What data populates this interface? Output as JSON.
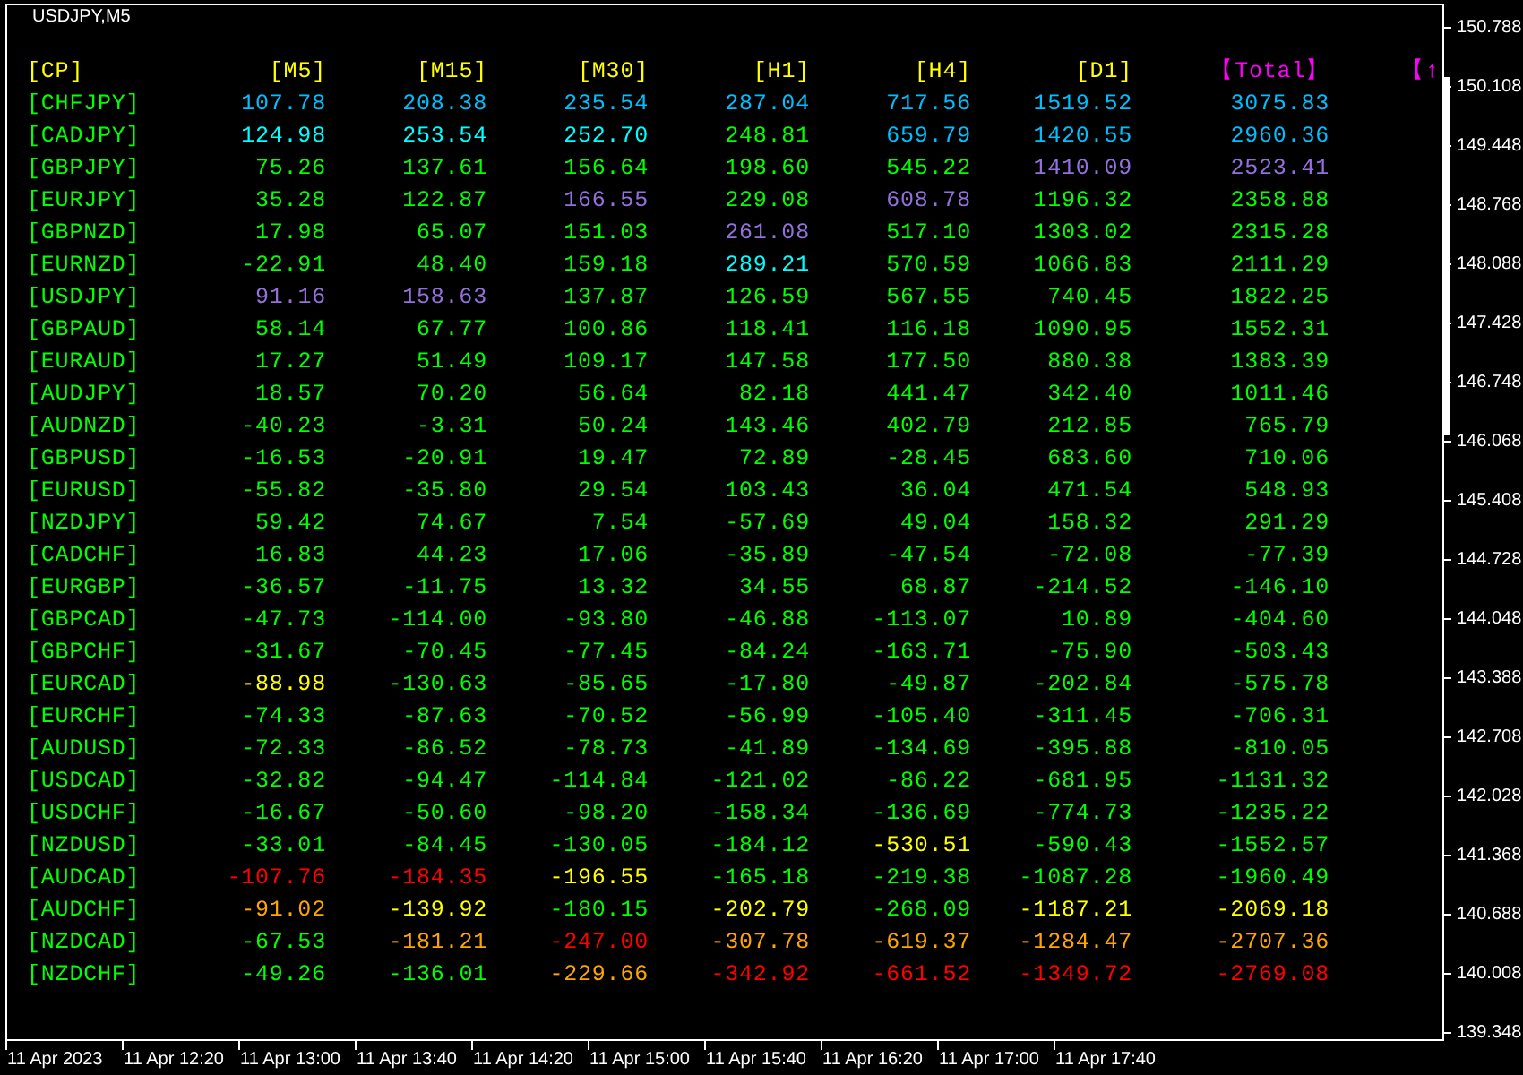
{
  "chart": {
    "title": "USDJPY,M5"
  },
  "table": {
    "columns": [
      {
        "label": "[CP]",
        "color": "#ffff00"
      },
      {
        "label": "[M5]",
        "color": "#ffff00"
      },
      {
        "label": "[M15]",
        "color": "#ffff00"
      },
      {
        "label": "[M30]",
        "color": "#ffff00"
      },
      {
        "label": "[H1]",
        "color": "#ffff00"
      },
      {
        "label": "[H4]",
        "color": "#ffff00"
      },
      {
        "label": "[D1]",
        "color": "#ffff00"
      },
      {
        "label": "【Total】",
        "color": "#ff00ff"
      },
      {
        "label": "【↑",
        "color": "#ff00ff"
      }
    ],
    "rows": [
      {
        "cells": [
          {
            "text": "[CHFJPY]",
            "color": "#00ff00"
          },
          {
            "text": "107.78",
            "color": "#00bfff"
          },
          {
            "text": "208.38",
            "color": "#00bfff"
          },
          {
            "text": "235.54",
            "color": "#00bfff"
          },
          {
            "text": "287.04",
            "color": "#00bfff"
          },
          {
            "text": "717.56",
            "color": "#00bfff"
          },
          {
            "text": "1519.52",
            "color": "#00bfff"
          },
          {
            "text": "3075.83",
            "color": "#00bfff"
          }
        ]
      },
      {
        "cells": [
          {
            "text": "[CADJPY]",
            "color": "#00ff00"
          },
          {
            "text": "124.98",
            "color": "#00ffff"
          },
          {
            "text": "253.54",
            "color": "#00ffff"
          },
          {
            "text": "252.70",
            "color": "#00ffff"
          },
          {
            "text": "248.81",
            "color": "#00ff00"
          },
          {
            "text": "659.79",
            "color": "#00bfff"
          },
          {
            "text": "1420.55",
            "color": "#00bfff"
          },
          {
            "text": "2960.36",
            "color": "#00bfff"
          }
        ]
      },
      {
        "cells": [
          {
            "text": "[GBPJPY]",
            "color": "#00ff00"
          },
          {
            "text": "75.26",
            "color": "#00ff00"
          },
          {
            "text": "137.61",
            "color": "#00ff00"
          },
          {
            "text": "156.64",
            "color": "#00ff00"
          },
          {
            "text": "198.60",
            "color": "#00ff00"
          },
          {
            "text": "545.22",
            "color": "#00ff00"
          },
          {
            "text": "1410.09",
            "color": "#9370db"
          },
          {
            "text": "2523.41",
            "color": "#9370db"
          }
        ]
      },
      {
        "cells": [
          {
            "text": "[EURJPY]",
            "color": "#00ff00"
          },
          {
            "text": "35.28",
            "color": "#00ff00"
          },
          {
            "text": "122.87",
            "color": "#00ff00"
          },
          {
            "text": "166.55",
            "color": "#9370db"
          },
          {
            "text": "229.08",
            "color": "#00ff00"
          },
          {
            "text": "608.78",
            "color": "#9370db"
          },
          {
            "text": "1196.32",
            "color": "#00ff00"
          },
          {
            "text": "2358.88",
            "color": "#00ff00"
          }
        ]
      },
      {
        "cells": [
          {
            "text": "[GBPNZD]",
            "color": "#00ff00"
          },
          {
            "text": "17.98",
            "color": "#00ff00"
          },
          {
            "text": "65.07",
            "color": "#00ff00"
          },
          {
            "text": "151.03",
            "color": "#00ff00"
          },
          {
            "text": "261.08",
            "color": "#9370db"
          },
          {
            "text": "517.10",
            "color": "#00ff00"
          },
          {
            "text": "1303.02",
            "color": "#00ff00"
          },
          {
            "text": "2315.28",
            "color": "#00ff00"
          }
        ]
      },
      {
        "cells": [
          {
            "text": "[EURNZD]",
            "color": "#00ff00"
          },
          {
            "text": "-22.91",
            "color": "#00ff00"
          },
          {
            "text": "48.40",
            "color": "#00ff00"
          },
          {
            "text": "159.18",
            "color": "#00ff00"
          },
          {
            "text": "289.21",
            "color": "#00ffff"
          },
          {
            "text": "570.59",
            "color": "#00ff00"
          },
          {
            "text": "1066.83",
            "color": "#00ff00"
          },
          {
            "text": "2111.29",
            "color": "#00ff00"
          }
        ]
      },
      {
        "cells": [
          {
            "text": "[USDJPY]",
            "color": "#00ff00"
          },
          {
            "text": "91.16",
            "color": "#9370db"
          },
          {
            "text": "158.63",
            "color": "#9370db"
          },
          {
            "text": "137.87",
            "color": "#00ff00"
          },
          {
            "text": "126.59",
            "color": "#00ff00"
          },
          {
            "text": "567.55",
            "color": "#00ff00"
          },
          {
            "text": "740.45",
            "color": "#00ff00"
          },
          {
            "text": "1822.25",
            "color": "#00ff00"
          }
        ]
      },
      {
        "cells": [
          {
            "text": "[GBPAUD]",
            "color": "#00ff00"
          },
          {
            "text": "58.14",
            "color": "#00ff00"
          },
          {
            "text": "67.77",
            "color": "#00ff00"
          },
          {
            "text": "100.86",
            "color": "#00ff00"
          },
          {
            "text": "118.41",
            "color": "#00ff00"
          },
          {
            "text": "116.18",
            "color": "#00ff00"
          },
          {
            "text": "1090.95",
            "color": "#00ff00"
          },
          {
            "text": "1552.31",
            "color": "#00ff00"
          }
        ]
      },
      {
        "cells": [
          {
            "text": "[EURAUD]",
            "color": "#00ff00"
          },
          {
            "text": "17.27",
            "color": "#00ff00"
          },
          {
            "text": "51.49",
            "color": "#00ff00"
          },
          {
            "text": "109.17",
            "color": "#00ff00"
          },
          {
            "text": "147.58",
            "color": "#00ff00"
          },
          {
            "text": "177.50",
            "color": "#00ff00"
          },
          {
            "text": "880.38",
            "color": "#00ff00"
          },
          {
            "text": "1383.39",
            "color": "#00ff00"
          }
        ]
      },
      {
        "cells": [
          {
            "text": "[AUDJPY]",
            "color": "#00ff00"
          },
          {
            "text": "18.57",
            "color": "#00ff00"
          },
          {
            "text": "70.20",
            "color": "#00ff00"
          },
          {
            "text": "56.64",
            "color": "#00ff00"
          },
          {
            "text": "82.18",
            "color": "#00ff00"
          },
          {
            "text": "441.47",
            "color": "#00ff00"
          },
          {
            "text": "342.40",
            "color": "#00ff00"
          },
          {
            "text": "1011.46",
            "color": "#00ff00"
          }
        ]
      },
      {
        "cells": [
          {
            "text": "[AUDNZD]",
            "color": "#00ff00"
          },
          {
            "text": "-40.23",
            "color": "#00ff00"
          },
          {
            "text": "-3.31",
            "color": "#00ff00"
          },
          {
            "text": "50.24",
            "color": "#00ff00"
          },
          {
            "text": "143.46",
            "color": "#00ff00"
          },
          {
            "text": "402.79",
            "color": "#00ff00"
          },
          {
            "text": "212.85",
            "color": "#00ff00"
          },
          {
            "text": "765.79",
            "color": "#00ff00"
          }
        ]
      },
      {
        "cells": [
          {
            "text": "[GBPUSD]",
            "color": "#00ff00"
          },
          {
            "text": "-16.53",
            "color": "#00ff00"
          },
          {
            "text": "-20.91",
            "color": "#00ff00"
          },
          {
            "text": "19.47",
            "color": "#00ff00"
          },
          {
            "text": "72.89",
            "color": "#00ff00"
          },
          {
            "text": "-28.45",
            "color": "#00ff00"
          },
          {
            "text": "683.60",
            "color": "#00ff00"
          },
          {
            "text": "710.06",
            "color": "#00ff00"
          }
        ]
      },
      {
        "cells": [
          {
            "text": "[EURUSD]",
            "color": "#00ff00"
          },
          {
            "text": "-55.82",
            "color": "#00ff00"
          },
          {
            "text": "-35.80",
            "color": "#00ff00"
          },
          {
            "text": "29.54",
            "color": "#00ff00"
          },
          {
            "text": "103.43",
            "color": "#00ff00"
          },
          {
            "text": "36.04",
            "color": "#00ff00"
          },
          {
            "text": "471.54",
            "color": "#00ff00"
          },
          {
            "text": "548.93",
            "color": "#00ff00"
          }
        ]
      },
      {
        "cells": [
          {
            "text": "[NZDJPY]",
            "color": "#00ff00"
          },
          {
            "text": "59.42",
            "color": "#00ff00"
          },
          {
            "text": "74.67",
            "color": "#00ff00"
          },
          {
            "text": "7.54",
            "color": "#00ff00"
          },
          {
            "text": "-57.69",
            "color": "#00ff00"
          },
          {
            "text": "49.04",
            "color": "#00ff00"
          },
          {
            "text": "158.32",
            "color": "#00ff00"
          },
          {
            "text": "291.29",
            "color": "#00ff00"
          }
        ]
      },
      {
        "cells": [
          {
            "text": "[CADCHF]",
            "color": "#00ff00"
          },
          {
            "text": "16.83",
            "color": "#00ff00"
          },
          {
            "text": "44.23",
            "color": "#00ff00"
          },
          {
            "text": "17.06",
            "color": "#00ff00"
          },
          {
            "text": "-35.89",
            "color": "#00ff00"
          },
          {
            "text": "-47.54",
            "color": "#00ff00"
          },
          {
            "text": "-72.08",
            "color": "#00ff00"
          },
          {
            "text": "-77.39",
            "color": "#00ff00"
          }
        ]
      },
      {
        "cells": [
          {
            "text": "[EURGBP]",
            "color": "#00ff00"
          },
          {
            "text": "-36.57",
            "color": "#00ff00"
          },
          {
            "text": "-11.75",
            "color": "#00ff00"
          },
          {
            "text": "13.32",
            "color": "#00ff00"
          },
          {
            "text": "34.55",
            "color": "#00ff00"
          },
          {
            "text": "68.87",
            "color": "#00ff00"
          },
          {
            "text": "-214.52",
            "color": "#00ff00"
          },
          {
            "text": "-146.10",
            "color": "#00ff00"
          }
        ]
      },
      {
        "cells": [
          {
            "text": "[GBPCAD]",
            "color": "#00ff00"
          },
          {
            "text": "-47.73",
            "color": "#00ff00"
          },
          {
            "text": "-114.00",
            "color": "#00ff00"
          },
          {
            "text": "-93.80",
            "color": "#00ff00"
          },
          {
            "text": "-46.88",
            "color": "#00ff00"
          },
          {
            "text": "-113.07",
            "color": "#00ff00"
          },
          {
            "text": "10.89",
            "color": "#00ff00"
          },
          {
            "text": "-404.60",
            "color": "#00ff00"
          }
        ]
      },
      {
        "cells": [
          {
            "text": "[GBPCHF]",
            "color": "#00ff00"
          },
          {
            "text": "-31.67",
            "color": "#00ff00"
          },
          {
            "text": "-70.45",
            "color": "#00ff00"
          },
          {
            "text": "-77.45",
            "color": "#00ff00"
          },
          {
            "text": "-84.24",
            "color": "#00ff00"
          },
          {
            "text": "-163.71",
            "color": "#00ff00"
          },
          {
            "text": "-75.90",
            "color": "#00ff00"
          },
          {
            "text": "-503.43",
            "color": "#00ff00"
          }
        ]
      },
      {
        "cells": [
          {
            "text": "[EURCAD]",
            "color": "#00ff00"
          },
          {
            "text": "-88.98",
            "color": "#ffff00"
          },
          {
            "text": "-130.63",
            "color": "#00ff00"
          },
          {
            "text": "-85.65",
            "color": "#00ff00"
          },
          {
            "text": "-17.80",
            "color": "#00ff00"
          },
          {
            "text": "-49.87",
            "color": "#00ff00"
          },
          {
            "text": "-202.84",
            "color": "#00ff00"
          },
          {
            "text": "-575.78",
            "color": "#00ff00"
          }
        ]
      },
      {
        "cells": [
          {
            "text": "[EURCHF]",
            "color": "#00ff00"
          },
          {
            "text": "-74.33",
            "color": "#00ff00"
          },
          {
            "text": "-87.63",
            "color": "#00ff00"
          },
          {
            "text": "-70.52",
            "color": "#00ff00"
          },
          {
            "text": "-56.99",
            "color": "#00ff00"
          },
          {
            "text": "-105.40",
            "color": "#00ff00"
          },
          {
            "text": "-311.45",
            "color": "#00ff00"
          },
          {
            "text": "-706.31",
            "color": "#00ff00"
          }
        ]
      },
      {
        "cells": [
          {
            "text": "[AUDUSD]",
            "color": "#00ff00"
          },
          {
            "text": "-72.33",
            "color": "#00ff00"
          },
          {
            "text": "-86.52",
            "color": "#00ff00"
          },
          {
            "text": "-78.73",
            "color": "#00ff00"
          },
          {
            "text": "-41.89",
            "color": "#00ff00"
          },
          {
            "text": "-134.69",
            "color": "#00ff00"
          },
          {
            "text": "-395.88",
            "color": "#00ff00"
          },
          {
            "text": "-810.05",
            "color": "#00ff00"
          }
        ]
      },
      {
        "cells": [
          {
            "text": "[USDCAD]",
            "color": "#00ff00"
          },
          {
            "text": "-32.82",
            "color": "#00ff00"
          },
          {
            "text": "-94.47",
            "color": "#00ff00"
          },
          {
            "text": "-114.84",
            "color": "#00ff00"
          },
          {
            "text": "-121.02",
            "color": "#00ff00"
          },
          {
            "text": "-86.22",
            "color": "#00ff00"
          },
          {
            "text": "-681.95",
            "color": "#00ff00"
          },
          {
            "text": "-1131.32",
            "color": "#00ff00"
          }
        ]
      },
      {
        "cells": [
          {
            "text": "[USDCHF]",
            "color": "#00ff00"
          },
          {
            "text": "-16.67",
            "color": "#00ff00"
          },
          {
            "text": "-50.60",
            "color": "#00ff00"
          },
          {
            "text": "-98.20",
            "color": "#00ff00"
          },
          {
            "text": "-158.34",
            "color": "#00ff00"
          },
          {
            "text": "-136.69",
            "color": "#00ff00"
          },
          {
            "text": "-774.73",
            "color": "#00ff00"
          },
          {
            "text": "-1235.22",
            "color": "#00ff00"
          }
        ]
      },
      {
        "cells": [
          {
            "text": "[NZDUSD]",
            "color": "#00ff00"
          },
          {
            "text": "-33.01",
            "color": "#00ff00"
          },
          {
            "text": "-84.45",
            "color": "#00ff00"
          },
          {
            "text": "-130.05",
            "color": "#00ff00"
          },
          {
            "text": "-184.12",
            "color": "#00ff00"
          },
          {
            "text": "-530.51",
            "color": "#ffff00"
          },
          {
            "text": "-590.43",
            "color": "#00ff00"
          },
          {
            "text": "-1552.57",
            "color": "#00ff00"
          }
        ]
      },
      {
        "cells": [
          {
            "text": "[AUDCAD]",
            "color": "#00ff00"
          },
          {
            "text": "-107.76",
            "color": "#ff0000"
          },
          {
            "text": "-184.35",
            "color": "#ff0000"
          },
          {
            "text": "-196.55",
            "color": "#ffff00"
          },
          {
            "text": "-165.18",
            "color": "#00ff00"
          },
          {
            "text": "-219.38",
            "color": "#00ff00"
          },
          {
            "text": "-1087.28",
            "color": "#00ff00"
          },
          {
            "text": "-1960.49",
            "color": "#00ff00"
          }
        ]
      },
      {
        "cells": [
          {
            "text": "[AUDCHF]",
            "color": "#00ff00"
          },
          {
            "text": "-91.02",
            "color": "#ffa500"
          },
          {
            "text": "-139.92",
            "color": "#ffff00"
          },
          {
            "text": "-180.15",
            "color": "#00ff00"
          },
          {
            "text": "-202.79",
            "color": "#ffff00"
          },
          {
            "text": "-268.09",
            "color": "#00ff00"
          },
          {
            "text": "-1187.21",
            "color": "#ffff00"
          },
          {
            "text": "-2069.18",
            "color": "#ffff00"
          }
        ]
      },
      {
        "cells": [
          {
            "text": "[NZDCAD]",
            "color": "#00ff00"
          },
          {
            "text": "-67.53",
            "color": "#00ff00"
          },
          {
            "text": "-181.21",
            "color": "#ffa500"
          },
          {
            "text": "-247.00",
            "color": "#ff0000"
          },
          {
            "text": "-307.78",
            "color": "#ffa500"
          },
          {
            "text": "-619.37",
            "color": "#ffa500"
          },
          {
            "text": "-1284.47",
            "color": "#ffa500"
          },
          {
            "text": "-2707.36",
            "color": "#ffa500"
          }
        ]
      },
      {
        "cells": [
          {
            "text": "[NZDCHF]",
            "color": "#00ff00"
          },
          {
            "text": "-49.26",
            "color": "#00ff00"
          },
          {
            "text": "-136.01",
            "color": "#00ff00"
          },
          {
            "text": "-229.66",
            "color": "#ffa500"
          },
          {
            "text": "-342.92",
            "color": "#ff0000"
          },
          {
            "text": "-661.52",
            "color": "#ff0000"
          },
          {
            "text": "-1349.72",
            "color": "#ff0000"
          },
          {
            "text": "-2769.08",
            "color": "#ff0000"
          }
        ]
      }
    ]
  },
  "price_axis": [
    "150.788",
    "150.108",
    "149.448",
    "148.768",
    "148.088",
    "147.428",
    "146.748",
    "146.068",
    "145.408",
    "144.728",
    "144.048",
    "143.388",
    "142.708",
    "142.028",
    "141.368",
    "140.688",
    "140.008",
    "139.348"
  ],
  "time_axis": [
    "11 Apr 2023",
    "11 Apr 12:20",
    "11 Apr 13:00",
    "11 Apr 13:40",
    "11 Apr 14:20",
    "11 Apr 15:00",
    "11 Apr 15:40",
    "11 Apr 16:20",
    "11 Apr 17:00",
    "11 Apr 17:40"
  ]
}
